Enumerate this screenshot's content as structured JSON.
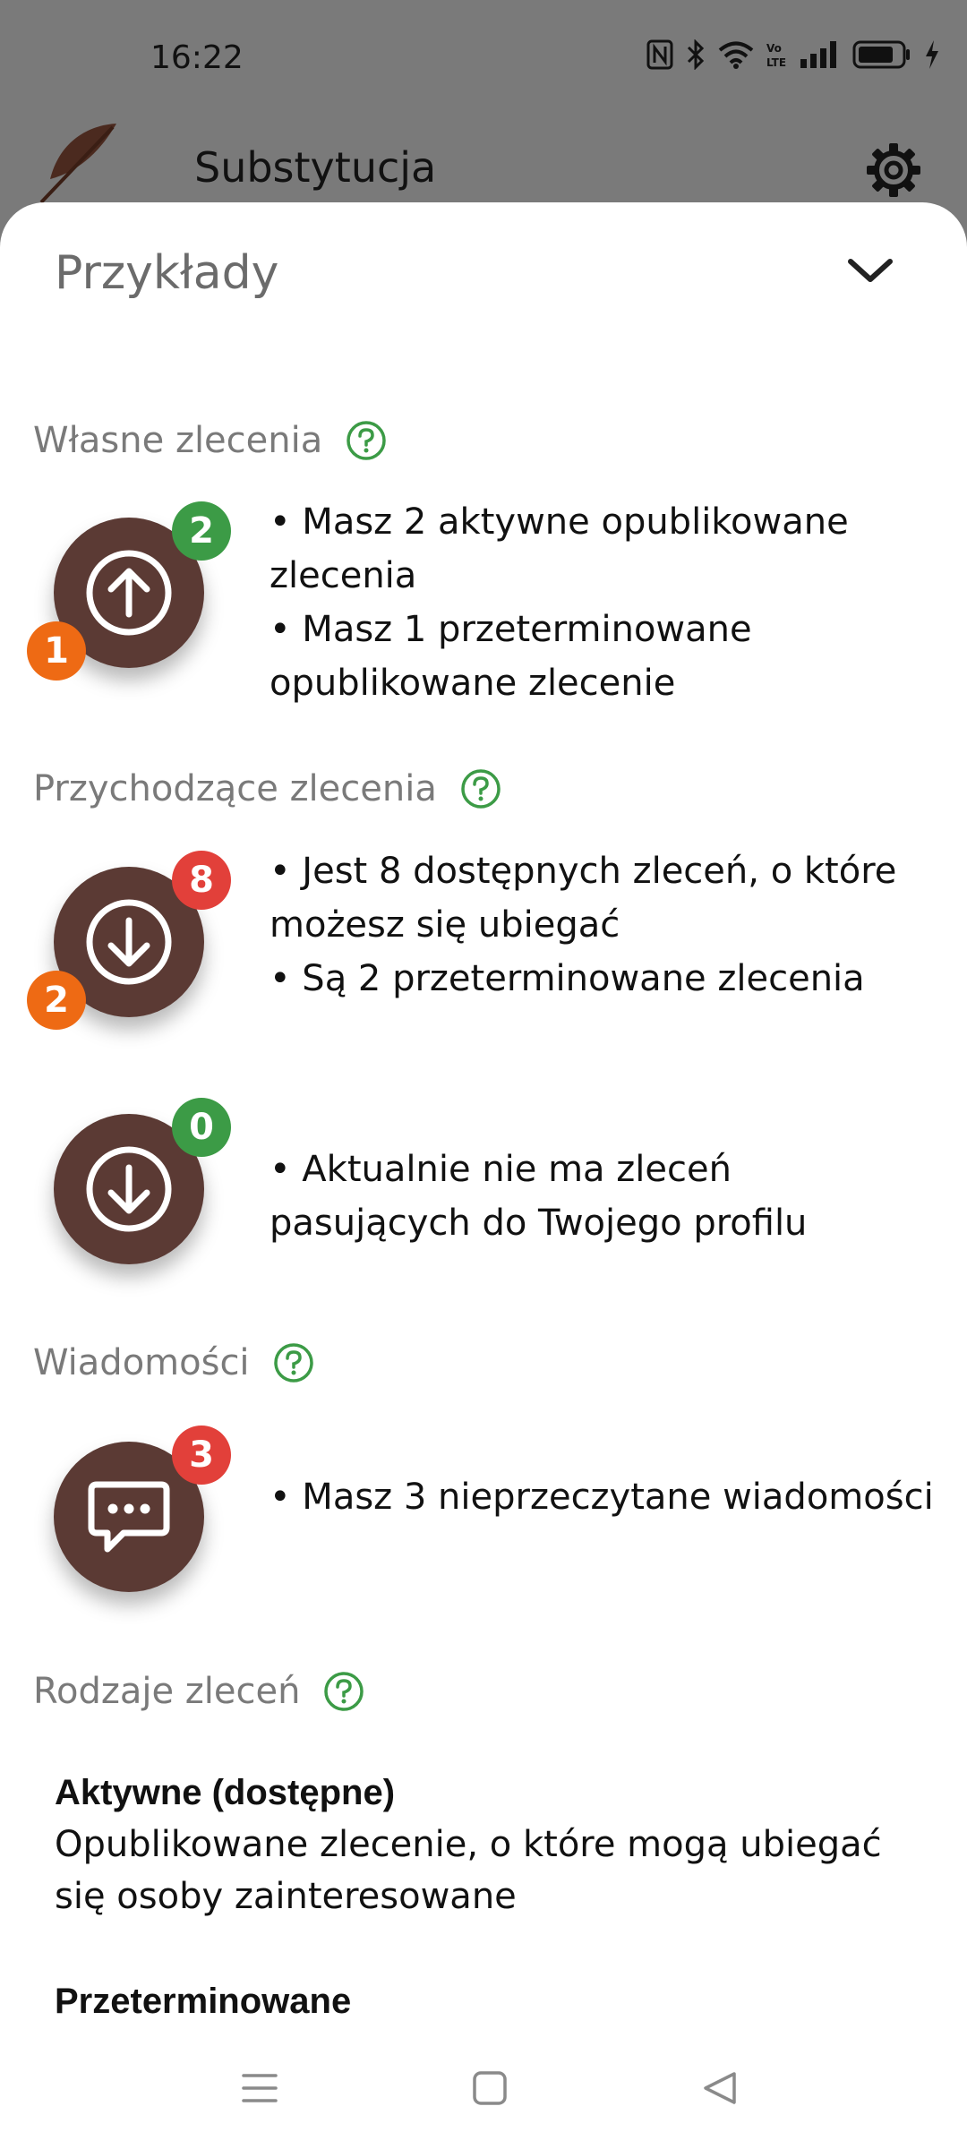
{
  "status_bar": {
    "time": "16:22",
    "icons": [
      "nfc-icon",
      "bluetooth-icon",
      "wifi-icon",
      "volte-icon",
      "signal-icon",
      "battery-icon",
      "charging-icon"
    ]
  },
  "app_bar": {
    "title": "Substytucja",
    "logo": "feather-logo",
    "settings_icon": "gear-icon"
  },
  "sheet": {
    "title": "Przykłady",
    "collapse_icon": "chevron-down-icon"
  },
  "sections": {
    "own": {
      "title": "Własne zlecenia",
      "example": {
        "icon": "arrow-up-circle-icon",
        "badge_top": "2",
        "badge_bottom": "1",
        "lines": [
          "• Masz 2 aktywne opublikowane zlecenia",
          "• Masz 1 przeterminowane opublikowane zlecenie"
        ]
      }
    },
    "incoming": {
      "title": "Przychodzące zlecenia",
      "example1": {
        "icon": "arrow-down-circle-icon",
        "badge_top": "8",
        "badge_bottom": "2",
        "lines": [
          "• Jest 8 dostępnych zleceń, o które możesz się ubiegać",
          "• Są 2 przeterminowane zlecenia"
        ]
      },
      "example2": {
        "icon": "arrow-down-circle-icon",
        "badge_top": "0",
        "lines": [
          "• Aktualnie nie ma zleceń pasujących do Twojego profilu"
        ]
      }
    },
    "messages": {
      "title": "Wiadomości",
      "example": {
        "icon": "chat-bubble-icon",
        "badge_top": "3",
        "lines": [
          "• Masz 3 nieprzeczytane wiadomości"
        ]
      }
    },
    "types": {
      "title": "Rodzaje zleceń",
      "items": [
        {
          "term": "Aktywne (dostępne)",
          "definition": "Opublikowane zlecenie, o które mogą ubiegać się osoby zainteresowane"
        },
        {
          "term": "Przeterminowane"
        }
      ]
    }
  },
  "colors": {
    "fab": "#5b3a34",
    "badge_green": "#3c9b46",
    "badge_red": "#e2403a",
    "badge_orange": "#ee6a14",
    "help_icon": "#3c9b46"
  },
  "nav_bar": [
    "menu-icon",
    "home-square-icon",
    "back-triangle-icon"
  ]
}
